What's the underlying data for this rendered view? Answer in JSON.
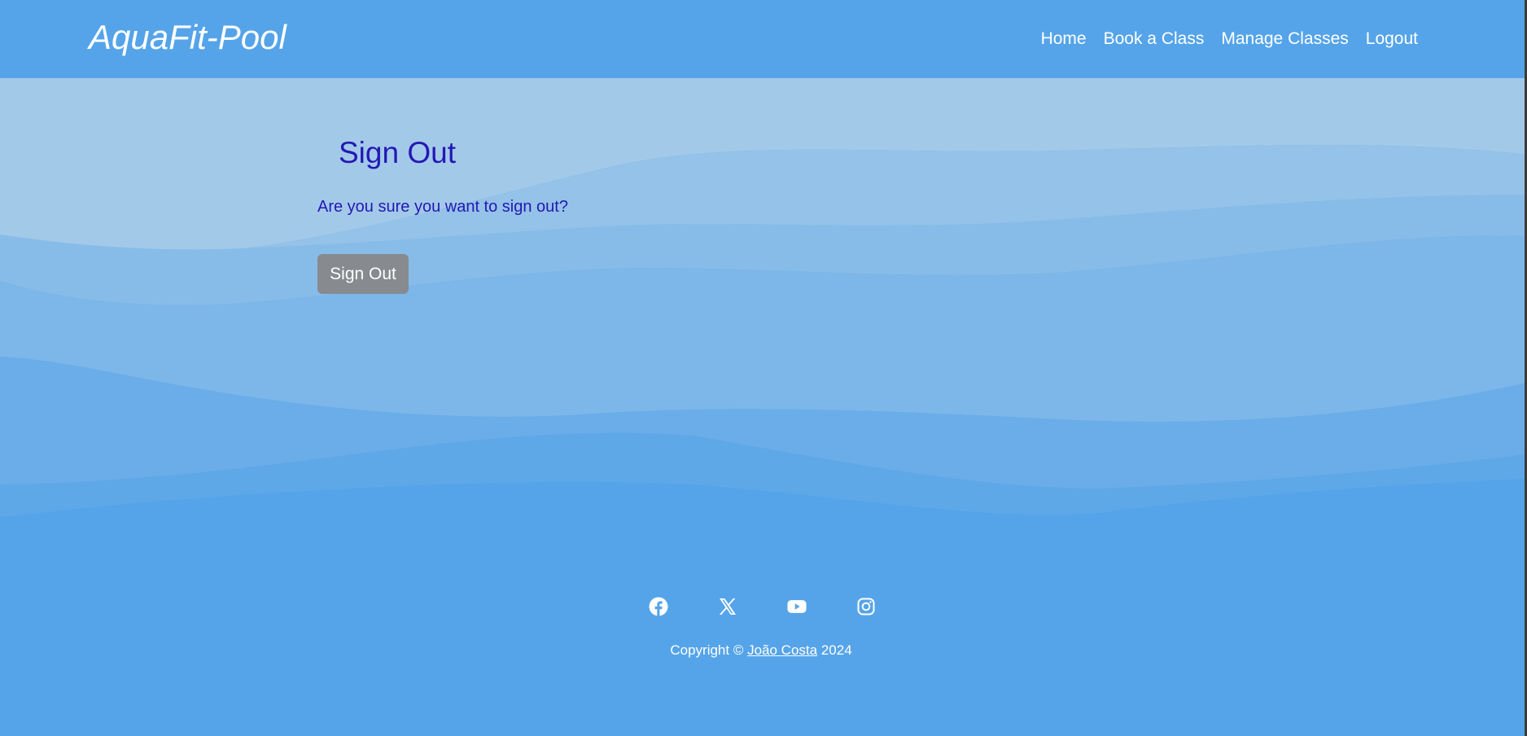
{
  "header": {
    "brand": "AquaFit-Pool",
    "nav": [
      {
        "label": "Home"
      },
      {
        "label": "Book a Class"
      },
      {
        "label": "Manage Classes"
      },
      {
        "label": "Logout"
      }
    ]
  },
  "main": {
    "title": "Sign Out",
    "question": "Are you sure you want to sign out?",
    "button_label": "Sign Out"
  },
  "footer": {
    "socials": [
      {
        "icon": "facebook-icon"
      },
      {
        "icon": "x-twitter-icon"
      },
      {
        "icon": "youtube-icon"
      },
      {
        "icon": "instagram-icon"
      }
    ],
    "copyright_prefix": "Copyright ©",
    "author": "João Costa",
    "year": "2024"
  },
  "colors": {
    "primary": "#55a4e9",
    "heading_text": "#2419b4",
    "button": "#878a8f"
  }
}
